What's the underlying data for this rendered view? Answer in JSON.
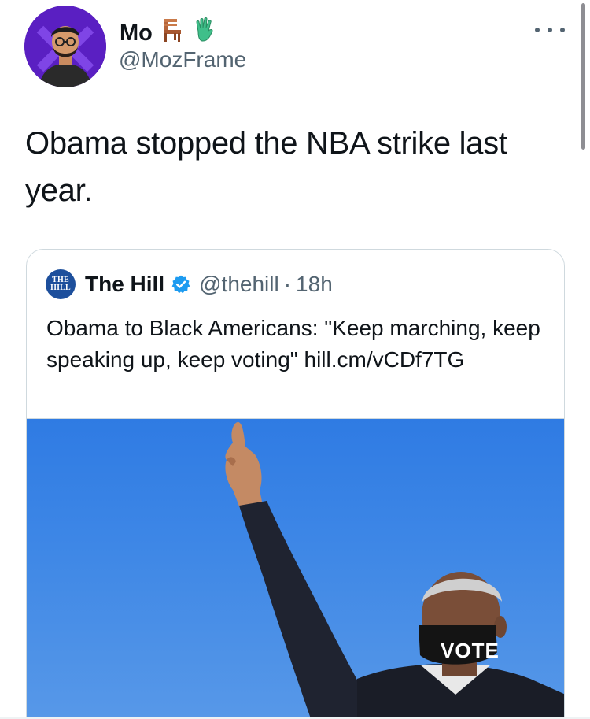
{
  "author": {
    "name": "Mo",
    "handle": "@MozFrame",
    "emojis": [
      "chair-emoji",
      "raised-hand-emoji"
    ],
    "avatar_bg": "#6a24d6"
  },
  "tweet": {
    "text": "Obama stopped the NBA strike last year."
  },
  "quote": {
    "logo_line1": "THE",
    "logo_line2": "HILL",
    "name": "The Hill",
    "handle": "@thehill",
    "separator": "·",
    "time": "18h",
    "text": "Obama to Black Americans: \"Keep marching, keep speaking up, keep voting\" hill.cm/vCDf7TG",
    "image_mask_text": "VOTE",
    "logo_color": "#1d4f9c",
    "verified_color": "#1d9bf0"
  },
  "icons": {
    "more": "more-horizontal-icon",
    "verified": "verified-badge-icon"
  }
}
